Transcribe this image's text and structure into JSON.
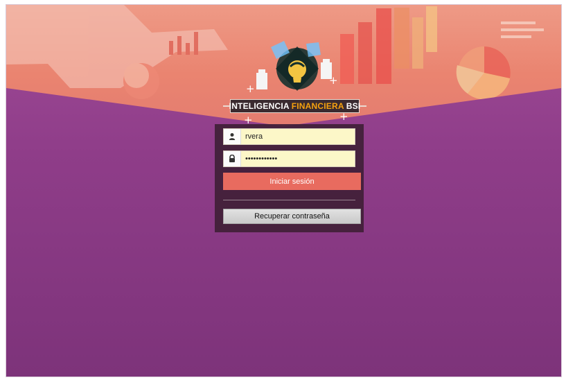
{
  "brand": {
    "logo_text_left": "INTELIGENCIA",
    "logo_text_highlight": "FINANCIERA",
    "logo_text_right": "BSI",
    "accent_color": "#f6a20f"
  },
  "login": {
    "username_value": "rvera",
    "password_value": "••••••••••••",
    "submit_label": "Iniciar sesión",
    "recover_label": "Recuperar contraseña"
  },
  "icons": {
    "username": "user-icon",
    "password": "lock-icon",
    "logo": "finance-lightbulb-logo-icon"
  },
  "colors": {
    "top_background": "#ea8470",
    "bottom_background": "#8f3d89",
    "login_panel": "#401f37",
    "field_background": "#fcf7c8",
    "submit_button": "#e86b5f",
    "recover_button": "#d2d2d2"
  }
}
